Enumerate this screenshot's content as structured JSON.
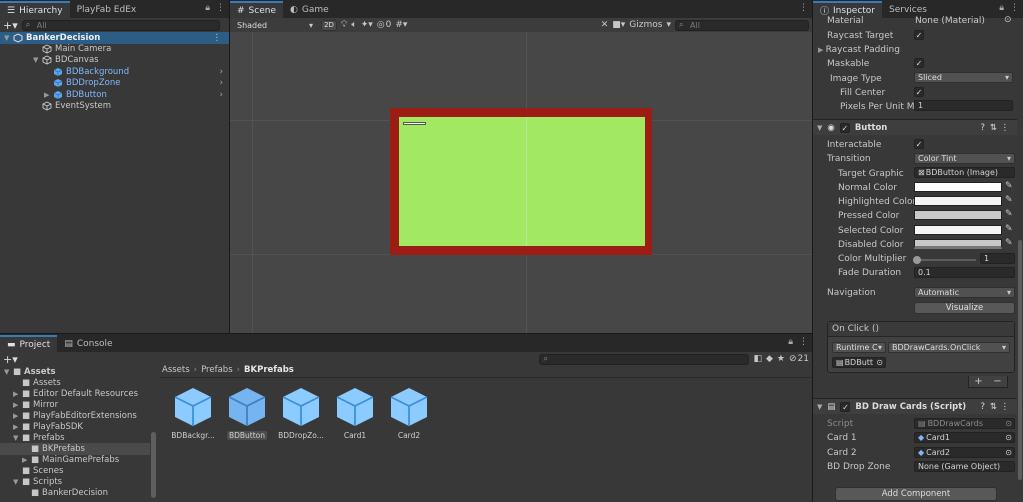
{
  "hierarchy": {
    "tabs": [
      "Hierarchy",
      "PlayFab EdEx"
    ],
    "search_placeholder": "All",
    "scene_name": "BankerDecision",
    "items": [
      "Main Camera",
      "BDCanvas",
      "BDBackground",
      "BDDropZone",
      "BDButton",
      "EventSystem"
    ]
  },
  "scene": {
    "tabs": [
      "Scene",
      "Game"
    ],
    "shading": "Shaded",
    "mode_2d": "2D",
    "hidden_count": "0",
    "gizmos": "Gizmos",
    "search_placeholder": "All",
    "colors": {
      "panel": "#9b1d14",
      "canvas": "#a2e862",
      "background": "#474747"
    }
  },
  "project": {
    "tabs": [
      "Project",
      "Console"
    ],
    "hidden_count": "21",
    "tree": [
      "Assets",
      "Assets",
      "Editor Default Resources",
      "Mirror",
      "PlayFabEditorExtensions",
      "PlayFabSDK",
      "Prefabs",
      "BKPrefabs",
      "MainGamePrefabs",
      "Scenes",
      "Scripts",
      "BankerDecision"
    ],
    "breadcrumb": [
      "Assets",
      "Prefabs",
      "BKPrefabs"
    ],
    "assets": [
      "BDBackgr...",
      "BDButton",
      "BDDropZo...",
      "Card1",
      "Card2"
    ]
  },
  "inspector": {
    "tabs": [
      "Inspector",
      "Services"
    ],
    "image": {
      "material_label": "Material",
      "material_value": "None (Material)",
      "raycast_target": "Raycast Target",
      "raycast_padding": "Raycast Padding",
      "maskable": "Maskable",
      "image_type_label": "Image Type",
      "image_type_value": "Sliced",
      "fill_center": "Fill Center",
      "ppu_label": "Pixels Per Unit Mul",
      "ppu_value": "1"
    },
    "button": {
      "title": "Button",
      "interactable": "Interactable",
      "transition_label": "Transition",
      "transition_value": "Color Tint",
      "target_graphic_label": "Target Graphic",
      "target_graphic_value": "BDButton (Image)",
      "normal_color": "Normal Color",
      "highlighted_color": "Highlighted Color",
      "pressed_color": "Pressed Color",
      "selected_color": "Selected Color",
      "disabled_color": "Disabled Color",
      "color_multiplier_label": "Color Multiplier",
      "color_multiplier_value": "1",
      "fade_duration_label": "Fade Duration",
      "fade_duration_value": "0.1",
      "navigation_label": "Navigation",
      "navigation_value": "Automatic",
      "visualize": "Visualize",
      "onclick_title": "On Click ()",
      "runtime": "Runtime C",
      "function": "BDDrawCards.OnClick",
      "object": "BDButt",
      "swatches": {
        "normal": "#ffffff",
        "highlighted": "#f5f5f5",
        "pressed": "#c8c8c8",
        "selected": "#f5f5f5",
        "disabled": "#c8c8c8"
      }
    },
    "script": {
      "title": "BD Draw Cards (Script)",
      "script_label": "Script",
      "script_value": "BDDrawCards",
      "card1_label": "Card 1",
      "card1_value": "Card1",
      "card2_label": "Card 2",
      "card2_value": "Card2",
      "dropzone_label": "BD Drop Zone",
      "dropzone_value": "None (Game Object)"
    },
    "add_component": "Add Component"
  }
}
